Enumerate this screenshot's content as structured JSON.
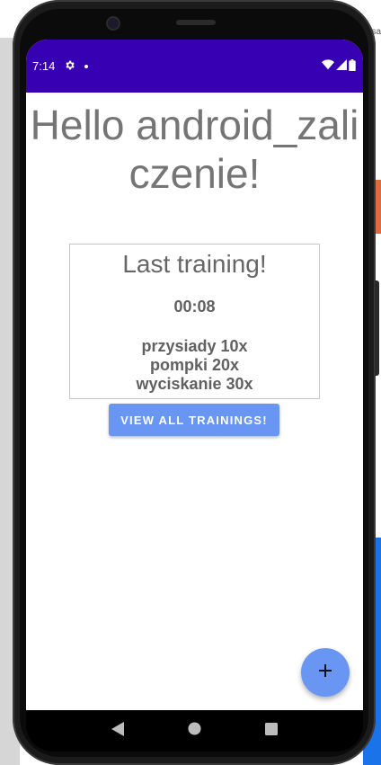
{
  "status_bar": {
    "time": "7:14",
    "icons": [
      "gear-icon",
      "dot-icon",
      "wifi-icon",
      "signal-icon",
      "battery-icon"
    ],
    "background": "#3700b3"
  },
  "main": {
    "greeting": "Hello android_zaliczenie!",
    "last_training": {
      "title": "Last training!",
      "duration": "00:08",
      "exercises": [
        "przysiady 10x",
        "pompki 20x",
        "wyciskanie 30x"
      ]
    },
    "view_all_button": "VIEW ALL TRAININGS!",
    "fab_icon": "plus-icon",
    "accent": "#6a96f3"
  },
  "nav_bar": {
    "icons": [
      "back-icon",
      "home-icon",
      "recents-icon"
    ]
  },
  "desktop": {
    "corner_text": "sa"
  }
}
